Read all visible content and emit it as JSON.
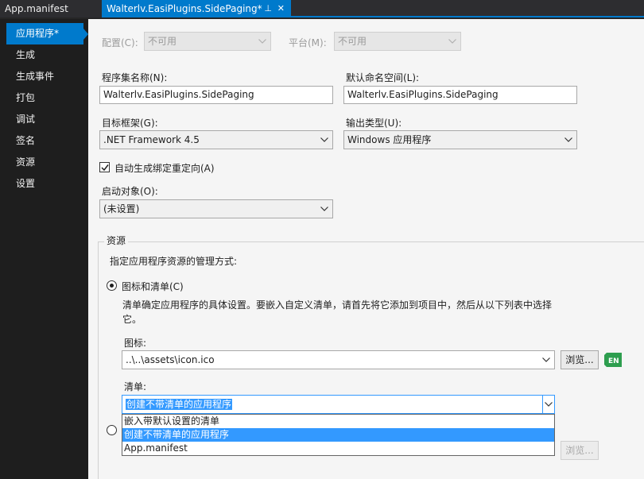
{
  "tabs": {
    "inactive_label": "App.manifest",
    "active_label": "Walterlv.EasiPlugins.SidePaging*",
    "pin_glyph": "⊥",
    "close_glyph": "✕"
  },
  "nav": {
    "items": [
      {
        "label": "应用程序*"
      },
      {
        "label": "生成"
      },
      {
        "label": "生成事件"
      },
      {
        "label": "打包"
      },
      {
        "label": "调试"
      },
      {
        "label": "签名"
      },
      {
        "label": "资源"
      },
      {
        "label": "设置"
      }
    ]
  },
  "config": {
    "config_label": "配置(C):",
    "config_value": "不可用",
    "platform_label": "平台(M):",
    "platform_value": "不可用"
  },
  "assembly": {
    "name_label": "程序集名称(N):",
    "name_value": "Walterlv.EasiPlugins.SidePaging",
    "namespace_label": "默认命名空间(L):",
    "namespace_value": "Walterlv.EasiPlugins.SidePaging",
    "framework_label": "目标框架(G):",
    "framework_value": ".NET Framework 4.5",
    "output_label": "输出类型(U):",
    "output_value": "Windows 应用程序",
    "auto_binding_label": "自动生成绑定重定向(A)",
    "startup_label": "启动对象(O):",
    "startup_value": "(未设置)"
  },
  "resources": {
    "group_title": "资源",
    "description": "指定应用程序资源的管理方式:",
    "icon_manifest_radio": "图标和清单(C)",
    "manifest_help_line1": "清单确定应用程序的具体设置。要嵌入自定义清单，请首先将它添加到项目中，然后从以下列表中选择",
    "manifest_help_line2": "它。",
    "icon_label": "图标:",
    "icon_value": "..\\..\\assets\\icon.ico",
    "browse_label": "浏览...",
    "manifest_label": "清单:",
    "manifest_value": "创建不带清单的应用程序",
    "dropdown_options": [
      {
        "label": "嵌入带默认设置的清单"
      },
      {
        "label": "创建不带清单的应用程序"
      },
      {
        "label": "App.manifest"
      }
    ],
    "browse_disabled_label": "浏览..."
  },
  "colors": {
    "accent": "#007acc",
    "selection": "#3399ff",
    "en_badge": "#2e9e4f"
  },
  "icons": {
    "en_badge_text": "EN"
  }
}
